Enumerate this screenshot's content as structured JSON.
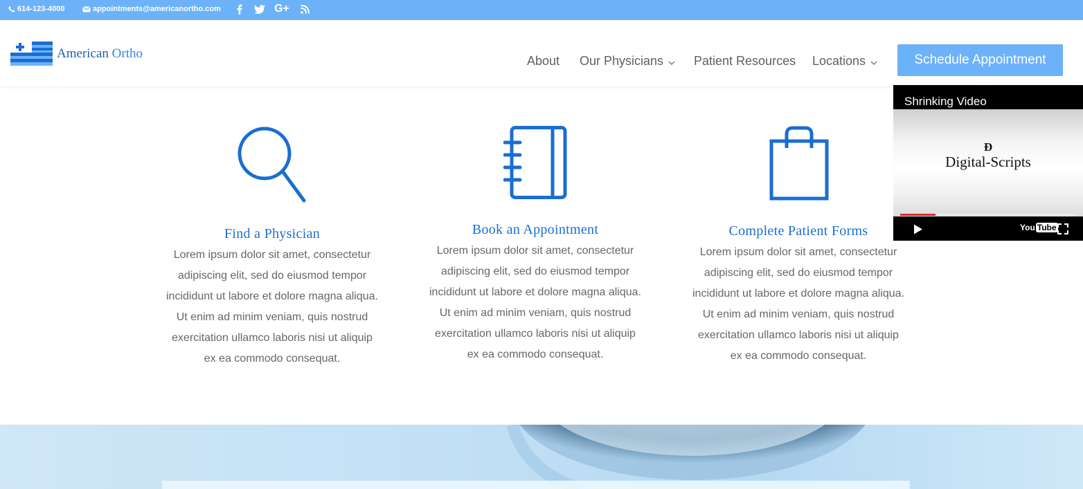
{
  "topbar": {
    "phone": "614-123-4000",
    "email": "appointments@americanortho.com",
    "social": [
      "facebook-icon",
      "twitter-icon",
      "google-plus-icon",
      "rss-icon"
    ]
  },
  "header": {
    "logo": {
      "word1": "American",
      "word2": "Ortho"
    },
    "nav": [
      {
        "label": "About",
        "has_dropdown": false
      },
      {
        "label": "Our Physicians",
        "has_dropdown": true
      },
      {
        "label": "Patient Resources",
        "has_dropdown": false
      },
      {
        "label": "Locations",
        "has_dropdown": true
      }
    ],
    "cta": "Schedule Appointment"
  },
  "features": [
    {
      "icon": "search-icon",
      "title": "Find a Physician",
      "text": "Lorem ipsum dolor sit amet, consectetur adipiscing elit, sed do eiusmod tempor incididunt ut labore et dolore magna aliqua. Ut enim ad minim veniam, quis nostrud exercitation ullamco laboris nisi ut aliquip ex ea commodo consequat."
    },
    {
      "icon": "notebook-icon",
      "title": "Book an Appointment",
      "text": "Lorem ipsum dolor sit amet, consectetur adipiscing elit, sed do eiusmod tempor incididunt ut labore et dolore magna aliqua. Ut enim ad minim veniam, quis nostrud exercitation ullamco laboris nisi ut aliquip ex ea commodo consequat."
    },
    {
      "icon": "shopping-bag-icon",
      "title": "Complete Patient Forms",
      "text": "Lorem ipsum dolor sit amet, consectetur adipiscing elit, sed do eiusmod tempor incididunt ut labore et dolore magna aliqua. Ut enim ad minim veniam, quis nostrud exercitation ullamco laboris nisi ut aliquip ex ea commodo consequat."
    }
  ],
  "video": {
    "title": "Shrinking Video",
    "mark": "Ð",
    "channel_text": "Digital-Scripts",
    "progress": 0.2,
    "youtube_label": {
      "you": "You",
      "tube": "Tube"
    }
  },
  "colors": {
    "topbar": "#6cb2f8",
    "accent": "#1a6ed0",
    "cta": "#6cb2f8",
    "progress": "#e52a2a"
  }
}
